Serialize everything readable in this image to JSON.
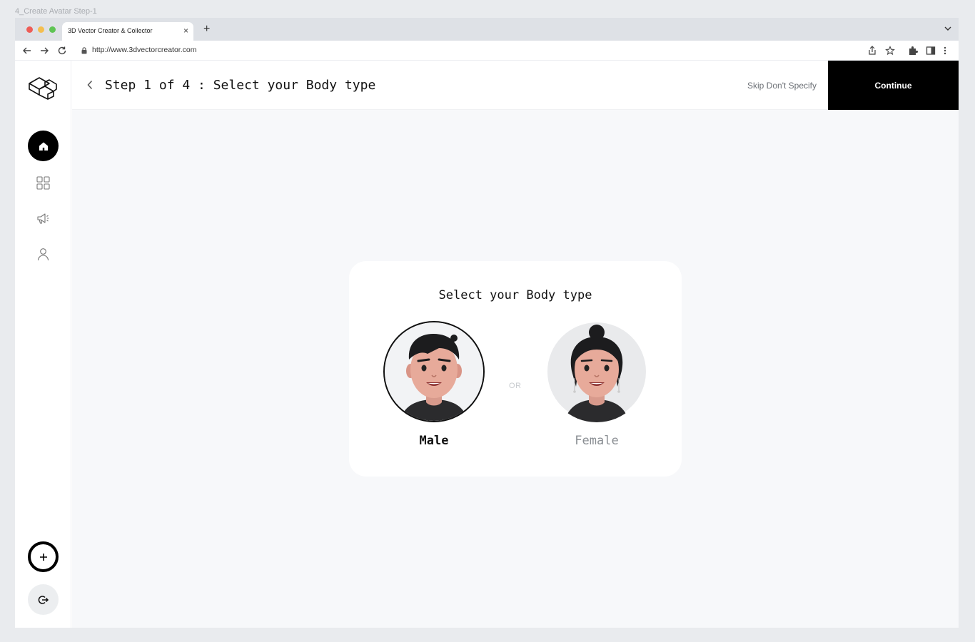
{
  "frame_label": "4_Create Avatar Step-1",
  "browser": {
    "tab_title": "3D Vector Creator & Collector",
    "tab_close": "×",
    "new_tab": "+",
    "url": "http://www.3dvectorcreator.com",
    "traffic_lights": [
      "#ee5d57",
      "#f4be4f",
      "#5fc454"
    ]
  },
  "sidebar": {
    "items": [
      {
        "icon": "home-icon",
        "active": true
      },
      {
        "icon": "grid-icon",
        "active": false
      },
      {
        "icon": "megaphone-icon",
        "active": false
      },
      {
        "icon": "user-icon",
        "active": false
      }
    ],
    "add_icon": "plus-icon",
    "logout_icon": "logout-icon"
  },
  "header": {
    "title": "Step 1 of 4 : Select your Body type",
    "skip_label": "Skip Don't Specify",
    "continue_label": "Continue"
  },
  "card": {
    "title": "Select your Body type",
    "separator": "OR",
    "options": [
      {
        "label": "Male",
        "selected": true
      },
      {
        "label": "Female",
        "selected": false
      }
    ]
  },
  "colors": {
    "accent": "#000000",
    "selected_text": "#111111",
    "unselected_text": "#8a8e93",
    "content_bg": "#f7f8fa"
  }
}
